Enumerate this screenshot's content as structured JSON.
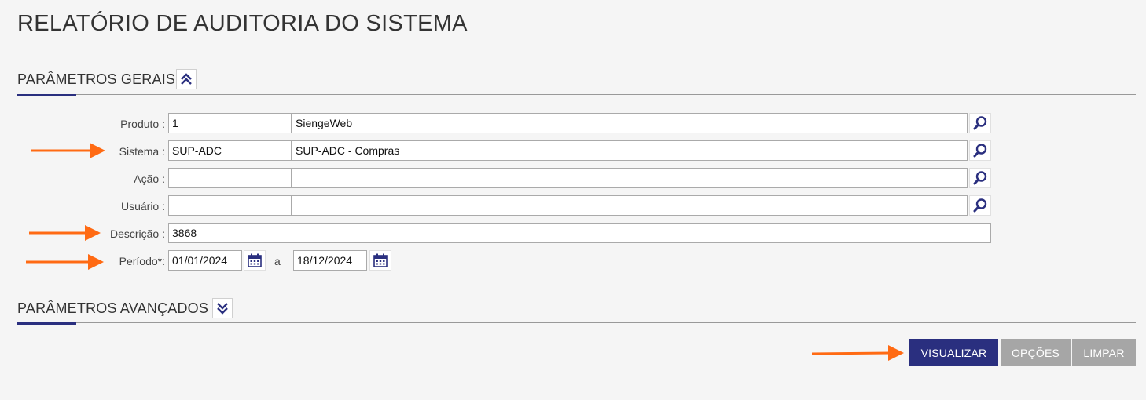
{
  "page": {
    "title": "RELATÓRIO DE AUDITORIA DO SISTEMA"
  },
  "sections": {
    "general": {
      "title": "PARÂMETROS GERAIS",
      "toggle_icon": "chevron-double-up-icon"
    },
    "advanced": {
      "title": "PARÂMETROS AVANÇADOS",
      "toggle_icon": "chevron-double-down-icon"
    }
  },
  "fields": {
    "produto": {
      "label": "Produto :",
      "code": "1",
      "description": "SiengeWeb"
    },
    "sistema": {
      "label": "Sistema :",
      "code": "SUP-ADC",
      "description": "SUP-ADC - Compras"
    },
    "acao": {
      "label": "Ação :",
      "code": "",
      "description": ""
    },
    "usuario": {
      "label": "Usuário :",
      "code": "",
      "description": ""
    },
    "descricao": {
      "label": "Descrição :",
      "value": "3868"
    },
    "periodo": {
      "label": "Período*:",
      "start": "01/01/2024",
      "between": "a",
      "end": "18/12/2024"
    }
  },
  "buttons": {
    "visualizar": "VISUALIZAR",
    "opcoes": "OPÇÕES",
    "limpar": "LIMPAR"
  },
  "colors": {
    "accent": "#2a2f7f",
    "secondary_button": "#a6a6a6",
    "annotation_arrow": "#ff6a13",
    "background": "#f5f5f5"
  },
  "icons": {
    "lookup": "search-icon",
    "date": "calendar-icon"
  }
}
